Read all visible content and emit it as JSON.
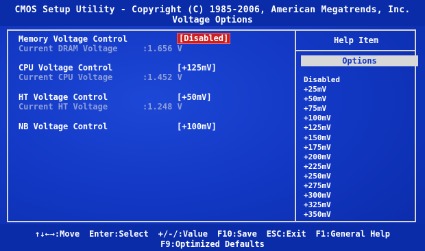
{
  "header": {
    "title_line1": "CMOS Setup Utility - Copyright (C) 1985-2006, American Megatrends, Inc.",
    "title_line2": "Voltage Options"
  },
  "settings": [
    {
      "label": "Memory Voltage Control",
      "value": "[Disabled]",
      "sub_label": "Current DRAM Voltage",
      "sub_value": ":1.656 V"
    },
    {
      "label": "CPU Voltage Control",
      "value": "[+125mV]",
      "sub_label": "Current CPU Voltage",
      "sub_value": ":1.452 V"
    },
    {
      "label": "HT Voltage Control",
      "value": "[+50mV]",
      "sub_label": "Current HT Voltage",
      "sub_value": ":1.248 V"
    },
    {
      "label": "NB Voltage Control",
      "value": "[+100mV]"
    }
  ],
  "help": {
    "title": "Help Item",
    "options_header": "Options",
    "options": [
      "Disabled",
      "+25mV",
      "+50mV",
      "+75mV",
      "+100mV",
      "+125mV",
      "+150mV",
      "+175mV",
      "+200mV",
      "+225mV",
      "+250mV",
      "+275mV",
      "+300mV",
      "+325mV",
      "+350mV"
    ]
  },
  "footer": {
    "move": "↑↓←→:Move",
    "select": "Enter:Select",
    "value": "+/-/:Value",
    "save": "F10:Save",
    "exit": "ESC:Exit",
    "help": "F1:General Help",
    "defaults": "F9:Optimized Defaults"
  },
  "colors": {
    "background": "#1238c4",
    "selected_bg": "#cc2020",
    "frame": "#d8d8d8",
    "dim_text": "#8f9fd8"
  }
}
